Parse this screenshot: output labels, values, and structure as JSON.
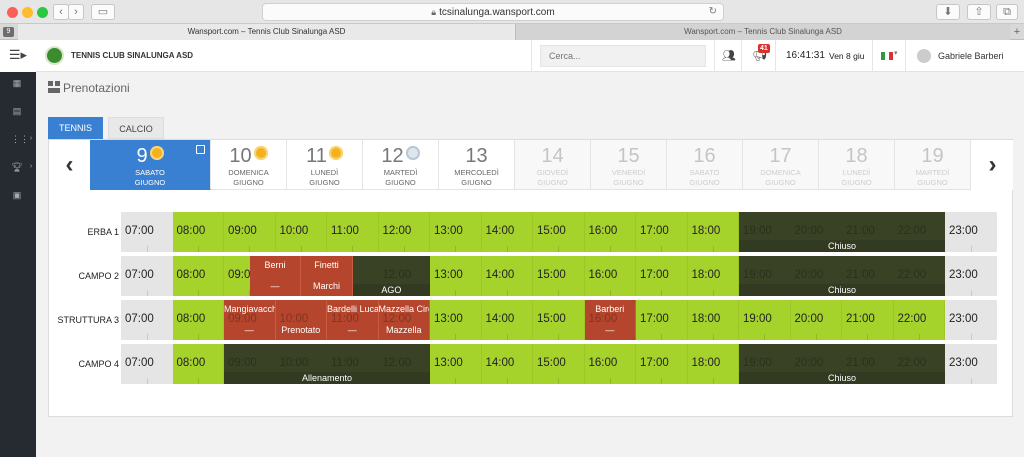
{
  "browser": {
    "url": "tcsinalunga.wansport.com",
    "tabs": [
      "Wansport.com – Tennis Club Sinalunga ASD",
      "Wansport.com – Tennis Club Sinalunga ASD"
    ],
    "pinned_tab_label": "9"
  },
  "header": {
    "club_name": "TENNIS CLUB SINALUNGA ASD",
    "search_placeholder": "Cerca...",
    "notifications_count": "41",
    "time": "16:41:31",
    "date": "Ven 8 giu",
    "user_name": "Gabriele Barberi"
  },
  "page": {
    "title": "Prenotazioni",
    "sport_tabs": [
      "TENNIS",
      "CALCIO"
    ],
    "active_sport": "TENNIS"
  },
  "days": [
    {
      "num": "9",
      "weekday": "SABATO",
      "month": "GIUGNO",
      "selected": true,
      "disabled": false,
      "weather": "sun-icon"
    },
    {
      "num": "10",
      "weekday": "DOMENICA",
      "month": "GIUGNO",
      "selected": false,
      "disabled": false,
      "weather": "sun-icon"
    },
    {
      "num": "11",
      "weekday": "LUNEDÌ",
      "month": "GIUGNO",
      "selected": false,
      "disabled": false,
      "weather": "sun-icon"
    },
    {
      "num": "12",
      "weekday": "MARTEDÌ",
      "month": "GIUGNO",
      "selected": false,
      "disabled": false,
      "weather": "snow-icon"
    },
    {
      "num": "13",
      "weekday": "MERCOLEDÌ",
      "month": "GIUGNO",
      "selected": false,
      "disabled": false,
      "weather": ""
    },
    {
      "num": "14",
      "weekday": "GIOVEDÌ",
      "month": "GIUGNO",
      "selected": false,
      "disabled": true,
      "weather": ""
    },
    {
      "num": "15",
      "weekday": "VENERDÌ",
      "month": "GIUGNO",
      "selected": false,
      "disabled": true,
      "weather": ""
    },
    {
      "num": "16",
      "weekday": "SABATO",
      "month": "GIUGNO",
      "selected": false,
      "disabled": true,
      "weather": ""
    },
    {
      "num": "17",
      "weekday": "DOMENICA",
      "month": "GIUGNO",
      "selected": false,
      "disabled": true,
      "weather": ""
    },
    {
      "num": "18",
      "weekday": "LUNEDÌ",
      "month": "GIUGNO",
      "selected": false,
      "disabled": true,
      "weather": ""
    },
    {
      "num": "19",
      "weekday": "MARTEDÌ",
      "month": "GIUGNO",
      "selected": false,
      "disabled": true,
      "weather": ""
    }
  ],
  "hours": [
    "07:00",
    "08:00",
    "09:00",
    "10:00",
    "11:00",
    "12:00",
    "13:00",
    "14:00",
    "15:00",
    "16:00",
    "17:00",
    "18:00",
    "19:00",
    "20:00",
    "21:00",
    "22:00",
    "23:00"
  ],
  "courts": [
    {
      "name": "ERBA 1",
      "blocks": [
        {
          "start": 12,
          "end": 16,
          "kind": "dark",
          "l1": "",
          "l2": "",
          "bar": "Chiuso"
        }
      ]
    },
    {
      "name": "CAMPO 2",
      "blocks": [
        {
          "start": 2.5,
          "end": 3.5,
          "kind": "booked",
          "l1": "Berni",
          "l2": "—",
          "bar": ""
        },
        {
          "start": 3.5,
          "end": 4.5,
          "kind": "booked",
          "l1": "Finetti",
          "l2": "Marchi",
          "bar": ""
        },
        {
          "start": 4.5,
          "end": 6,
          "kind": "dark",
          "l1": "",
          "l2": "",
          "bar": "AGO"
        },
        {
          "start": 12,
          "end": 16,
          "kind": "dark",
          "l1": "",
          "l2": "",
          "bar": "Chiuso"
        }
      ]
    },
    {
      "name": "STRUTTURA 3",
      "blocks": [
        {
          "start": 2,
          "end": 3,
          "kind": "booked",
          "l1": "Mangiavacchi",
          "l2": "—",
          "bar": ""
        },
        {
          "start": 3,
          "end": 4,
          "kind": "booked",
          "l1": "",
          "l2": "Prenotato",
          "bar": ""
        },
        {
          "start": 4,
          "end": 5,
          "kind": "booked",
          "l1": "Bardelli Luca",
          "l2": "—",
          "bar": ""
        },
        {
          "start": 5,
          "end": 6,
          "kind": "booked",
          "l1": "Mazzella Ciro",
          "l2": "Mazzella",
          "bar": ""
        },
        {
          "start": 9,
          "end": 10,
          "kind": "booked",
          "l1": "Barberi",
          "l2": "—",
          "bar": ""
        }
      ]
    },
    {
      "name": "CAMPO 4",
      "blocks": [
        {
          "start": 2,
          "end": 6,
          "kind": "dark",
          "l1": "",
          "l2": "",
          "bar": "Allenamento"
        },
        {
          "start": 12,
          "end": 16,
          "kind": "dark",
          "l1": "",
          "l2": "",
          "bar": "Chiuso"
        }
      ]
    }
  ]
}
